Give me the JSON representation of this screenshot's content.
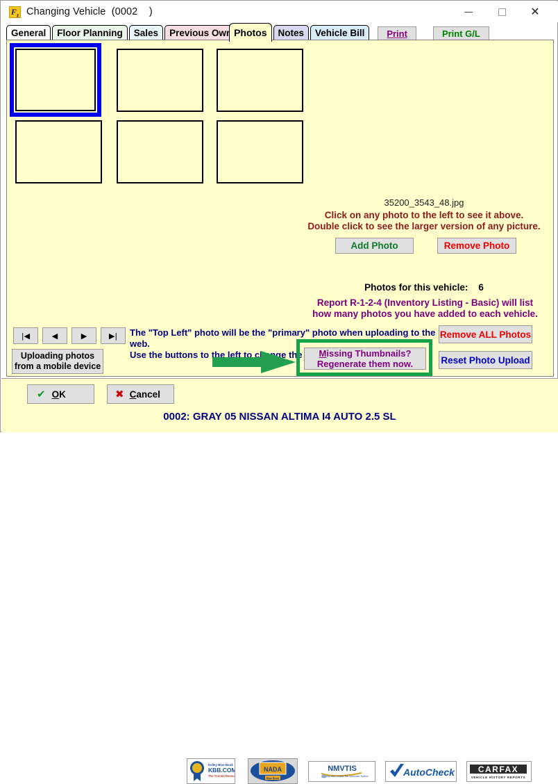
{
  "window": {
    "title": "Changing Vehicle  (0002    )",
    "app_icon": "fz-icon",
    "minimize_label": "minimize-icon",
    "maximize_label": "maximize-icon",
    "close_label": "close-icon"
  },
  "tabs": [
    {
      "label": "General",
      "color": "#ffffff",
      "active": false
    },
    {
      "label": "Floor Planning",
      "color": "#eaf6ea",
      "active": false
    },
    {
      "label": "Sales",
      "color": "#eaf6f8",
      "active": false
    },
    {
      "label": "Previous Owner",
      "color": "#fbdde4",
      "active": false
    },
    {
      "label": "Photos",
      "color": "#ffffcc",
      "active": true
    },
    {
      "label": "Notes",
      "color": "#d8d8f0",
      "active": false
    },
    {
      "label": "Vehicle Bill",
      "color": "#d8ecfa",
      "active": false
    }
  ],
  "tab_buttons": [
    {
      "label": "Print",
      "color": "#800080",
      "underline_first": true
    },
    {
      "label": "Print G/L",
      "color": "#008000",
      "underline_first": false
    }
  ],
  "photos": {
    "thumbnail_count": 6,
    "selected_index": 0,
    "filename": "35200_3543_48.jpg",
    "hint_line1": "Click on any photo to the left to see it above.",
    "hint_line2": "Double click to see the larger version of any picture.",
    "add_photo_label": "Add Photo",
    "remove_photo_label": "Remove Photo",
    "count_label": "Photos for this vehicle:    6",
    "report_line1": "Report R-1-2-4 (Inventory Listing - Basic) will list",
    "report_line2": "how many photos you have added to each vehicle."
  },
  "nav": {
    "first": "|◀",
    "prev": "◀",
    "next": "▶",
    "last": "▶|"
  },
  "bottom_controls": {
    "upload_mobile_line1": "Uploading photos",
    "upload_mobile_line2": "from a mobile device",
    "top_left_hint_line1": "The \"Top Left\" photo will be the \"primary\" photo when uploading to the web.",
    "top_left_hint_line2": "Use the buttons to the left to change the order of the photos.",
    "missing_thumbs_line1": "Missing Thumbnails?",
    "missing_thumbs_line1_accel": "M",
    "missing_thumbs_line1_rest": "issing Thumbnails?",
    "missing_thumbs_line2": "Regenerate them now.",
    "remove_all_label": "Remove ALL Photos",
    "reset_upload_label": "Reset Photo Upload",
    "arrow": "green-right-arrow",
    "highlight_color": "#15a34a"
  },
  "footer": {
    "ok_label": "OK",
    "ok_accel": "O",
    "ok_rest": "K",
    "cancel_label": "Cancel",
    "cancel_accel": "C",
    "cancel_rest": "ancel",
    "logos": [
      {
        "name": "kbb-logo",
        "text": "KBB.COM",
        "sub": "Kelley Blue Book"
      },
      {
        "name": "nada-logo",
        "text": "NADA",
        "sub": "Blue Book"
      },
      {
        "name": "nmvtis-logo",
        "text": "NMVTIS",
        "sub": ""
      },
      {
        "name": "autocheck-logo",
        "text": "AutoCheck",
        "sub": ""
      },
      {
        "name": "carfax-logo",
        "text": "CARFAX",
        "sub": "VEHICLE HISTORY REPORTS"
      }
    ],
    "vehicle_status": "0002: GRAY 05 NISSAN ALTIMA I4 AUTO 2.5 SL"
  },
  "colors": {
    "panel_bg": "#ffffcc",
    "selection_blue": "#0000f0",
    "hint_dark_red": "#8b1a1a",
    "report_purple": "#800080",
    "nav_blue": "#000080",
    "green": "#15a34a"
  }
}
